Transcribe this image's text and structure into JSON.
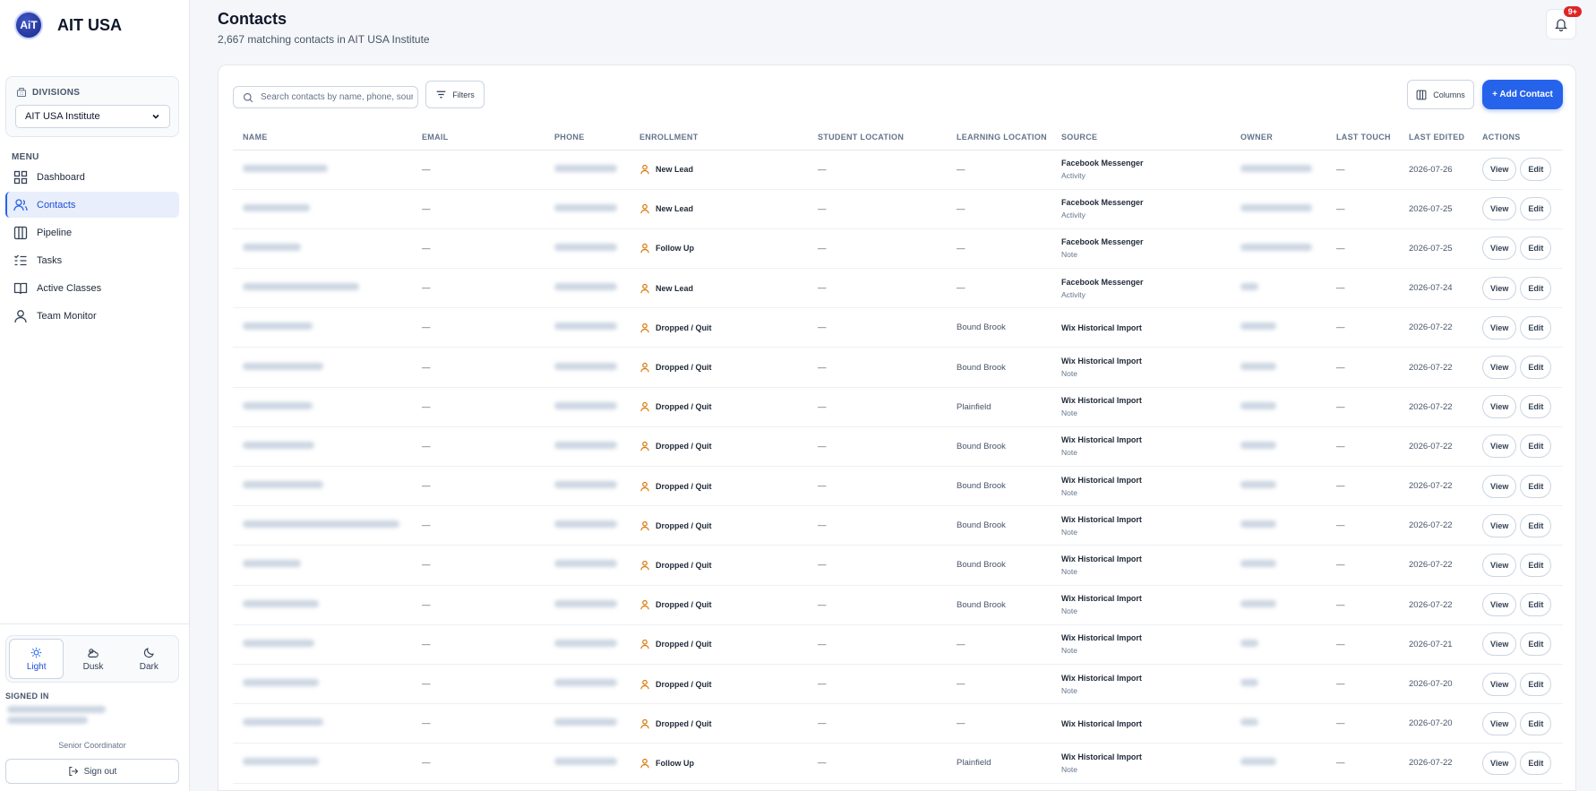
{
  "brand": {
    "logo_text": "AiT",
    "name": "AIT USA"
  },
  "divisions": {
    "label": "DIVISIONS",
    "selected": "AIT USA Institute"
  },
  "menu": {
    "title": "MENU",
    "items": [
      {
        "label": "Dashboard",
        "icon": "dashboard-icon",
        "active": false
      },
      {
        "label": "Contacts",
        "icon": "contacts-icon",
        "active": true
      },
      {
        "label": "Pipeline",
        "icon": "pipeline-icon",
        "active": false
      },
      {
        "label": "Tasks",
        "icon": "tasks-icon",
        "active": false
      },
      {
        "label": "Active Classes",
        "icon": "book-icon",
        "active": false
      },
      {
        "label": "Team Monitor",
        "icon": "team-icon",
        "active": false
      }
    ]
  },
  "theme": {
    "options": [
      "Light",
      "Dusk",
      "Dark"
    ],
    "selected": "Light"
  },
  "account": {
    "signed_in_label": "SIGNED IN",
    "role": "Senior Coordinator",
    "sign_out": "Sign out"
  },
  "header": {
    "title": "Contacts",
    "subtitle": "2,667 matching contacts in AIT USA Institute",
    "notification_count": "9+"
  },
  "toolbar": {
    "search_placeholder": "Search contacts by name, phone, source...",
    "filters": "Filters",
    "columns": "Columns",
    "add_contact": "+ Add Contact"
  },
  "table": {
    "columns": [
      "NAME",
      "EMAIL",
      "PHONE",
      "ENROLLMENT",
      "STUDENT LOCATION",
      "LEARNING LOCATION",
      "SOURCE",
      "OWNER",
      "LAST TOUCH",
      "LAST EDITED",
      "ACTIONS"
    ],
    "action_view": "View",
    "action_edit": "Edit",
    "rows": [
      {
        "email": "—",
        "enrollment": "New Lead",
        "student_location": "—",
        "learning_location": "—",
        "source": "Facebook Messenger",
        "source_sub": "Activity",
        "last_touch": "—",
        "last_edited": "2026-07-26"
      },
      {
        "email": "—",
        "enrollment": "New Lead",
        "student_location": "—",
        "learning_location": "—",
        "source": "Facebook Messenger",
        "source_sub": "Activity",
        "last_touch": "—",
        "last_edited": "2026-07-25"
      },
      {
        "email": "—",
        "enrollment": "Follow Up",
        "student_location": "—",
        "learning_location": "—",
        "source": "Facebook Messenger",
        "source_sub": "Note",
        "last_touch": "—",
        "last_edited": "2026-07-25"
      },
      {
        "email": "—",
        "enrollment": "New Lead",
        "student_location": "—",
        "learning_location": "—",
        "source": "Facebook Messenger",
        "source_sub": "Activity",
        "last_touch": "—",
        "last_edited": "2026-07-24"
      },
      {
        "email": "—",
        "enrollment": "Dropped / Quit",
        "student_location": "—",
        "learning_location": "Bound Brook",
        "source": "Wix Historical Import",
        "source_sub": "",
        "last_touch": "—",
        "last_edited": "2026-07-22"
      },
      {
        "email": "—",
        "enrollment": "Dropped / Quit",
        "student_location": "—",
        "learning_location": "Bound Brook",
        "source": "Wix Historical Import",
        "source_sub": "Note",
        "last_touch": "—",
        "last_edited": "2026-07-22"
      },
      {
        "email": "—",
        "enrollment": "Dropped / Quit",
        "student_location": "—",
        "learning_location": "Plainfield",
        "source": "Wix Historical Import",
        "source_sub": "Note",
        "last_touch": "—",
        "last_edited": "2026-07-22"
      },
      {
        "email": "—",
        "enrollment": "Dropped / Quit",
        "student_location": "—",
        "learning_location": "Bound Brook",
        "source": "Wix Historical Import",
        "source_sub": "Note",
        "last_touch": "—",
        "last_edited": "2026-07-22"
      },
      {
        "email": "—",
        "enrollment": "Dropped / Quit",
        "student_location": "—",
        "learning_location": "Bound Brook",
        "source": "Wix Historical Import",
        "source_sub": "Note",
        "last_touch": "—",
        "last_edited": "2026-07-22"
      },
      {
        "email": "—",
        "enrollment": "Dropped / Quit",
        "student_location": "—",
        "learning_location": "Bound Brook",
        "source": "Wix Historical Import",
        "source_sub": "Note",
        "last_touch": "—",
        "last_edited": "2026-07-22"
      },
      {
        "email": "—",
        "enrollment": "Dropped / Quit",
        "student_location": "—",
        "learning_location": "Bound Brook",
        "source": "Wix Historical Import",
        "source_sub": "Note",
        "last_touch": "—",
        "last_edited": "2026-07-22"
      },
      {
        "email": "—",
        "enrollment": "Dropped / Quit",
        "student_location": "—",
        "learning_location": "Bound Brook",
        "source": "Wix Historical Import",
        "source_sub": "Note",
        "last_touch": "—",
        "last_edited": "2026-07-22"
      },
      {
        "email": "—",
        "enrollment": "Dropped / Quit",
        "student_location": "—",
        "learning_location": "—",
        "source": "Wix Historical Import",
        "source_sub": "Note",
        "last_touch": "—",
        "last_edited": "2026-07-21"
      },
      {
        "email": "—",
        "enrollment": "Dropped / Quit",
        "student_location": "—",
        "learning_location": "—",
        "source": "Wix Historical Import",
        "source_sub": "Note",
        "last_touch": "—",
        "last_edited": "2026-07-20"
      },
      {
        "email": "—",
        "enrollment": "Dropped / Quit",
        "student_location": "—",
        "learning_location": "—",
        "source": "Wix Historical Import",
        "source_sub": "",
        "last_touch": "—",
        "last_edited": "2026-07-20"
      },
      {
        "email": "—",
        "enrollment": "Follow Up",
        "student_location": "—",
        "learning_location": "Plainfield",
        "source": "Wix Historical Import",
        "source_sub": "Note",
        "last_touch": "—",
        "last_edited": "2026-07-22"
      }
    ]
  },
  "colors": {
    "accent": "#2563eb",
    "enrollment_icon": "#d97706",
    "badge": "#dc2626"
  }
}
